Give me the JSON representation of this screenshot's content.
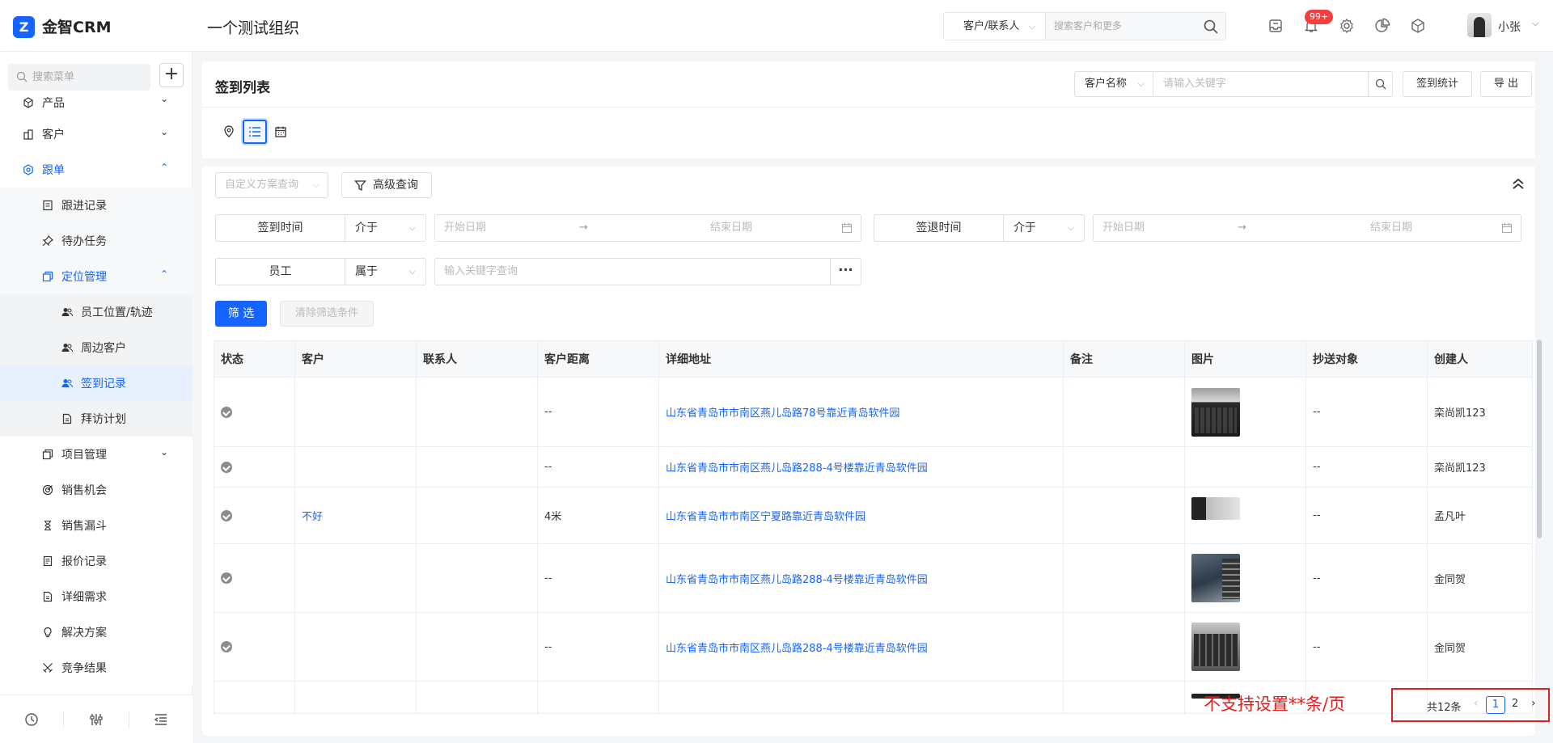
{
  "header": {
    "brand": "金智CRM",
    "org_title": "一个测试组织",
    "search_type": "客户/联系人",
    "search_placeholder": "搜索客户和更多",
    "notification_badge": "99+",
    "username": "小张"
  },
  "sidebar": {
    "search_placeholder": "搜索菜单",
    "add_label": "+",
    "items": [
      {
        "label": "产品",
        "level": 1,
        "arrow": "⌄",
        "icon": "cube-icon"
      },
      {
        "label": "客户",
        "level": 1,
        "arrow": "⌄",
        "icon": "building-icon"
      },
      {
        "label": "跟单",
        "level": 1,
        "arrow": "⌃",
        "icon": "hexagon-icon",
        "active": true
      },
      {
        "label": "跟进记录",
        "level": 2,
        "icon": "note-icon"
      },
      {
        "label": "待办任务",
        "level": 2,
        "icon": "pin-icon"
      },
      {
        "label": "定位管理",
        "level": 2,
        "arrow": "⌃",
        "icon": "copy-icon",
        "active": true
      },
      {
        "label": "员工位置/轨迹",
        "level": 3,
        "icon": "users-icon"
      },
      {
        "label": "周边客户",
        "level": 3,
        "icon": "users-icon"
      },
      {
        "label": "签到记录",
        "level": 3,
        "icon": "users-icon",
        "selected": true
      },
      {
        "label": "拜访计划",
        "level": 3,
        "icon": "doc-icon"
      },
      {
        "label": "项目管理",
        "level": 2,
        "arrow": "⌄",
        "icon": "copy-icon"
      },
      {
        "label": "销售机会",
        "level": 2,
        "icon": "target-icon"
      },
      {
        "label": "销售漏斗",
        "level": 2,
        "icon": "hourglass-icon"
      },
      {
        "label": "报价记录",
        "level": 2,
        "icon": "receipt-icon"
      },
      {
        "label": "详细需求",
        "level": 2,
        "icon": "doc-icon"
      },
      {
        "label": "解决方案",
        "level": 2,
        "icon": "bulb-icon"
      },
      {
        "label": "竞争结果",
        "level": 2,
        "icon": "swords-icon"
      }
    ]
  },
  "main": {
    "title": "签到列表",
    "search_field": "客户名称",
    "search_placeholder": "请输入关键字",
    "btn_stats": "签到统计",
    "btn_export": "导 出",
    "custom_scheme_placeholder": "自定义方案查询",
    "adv_query": "高级查询",
    "filters": {
      "checkin_label": "签到时间",
      "checkin_op": "介于",
      "checkin_start": "开始日期",
      "checkin_end": "结束日期",
      "checkout_label": "签退时间",
      "checkout_op": "介于",
      "checkout_start": "开始日期",
      "checkout_end": "结束日期",
      "employee_label": "员工",
      "employee_op": "属于",
      "employee_placeholder": "输入关键字查询",
      "range_arrow": "→",
      "more": "···"
    },
    "btn_filter": "筛 选",
    "btn_clear": "清除筛选条件",
    "columns": [
      "状态",
      "客户",
      "联系人",
      "客户距离",
      "详细地址",
      "备注",
      "图片",
      "抄送对象",
      "创建人"
    ],
    "rows": [
      {
        "customer": "",
        "contact": "",
        "distance": "--",
        "address": "山东省青岛市市南区燕儿岛路78号靠近青岛软件园",
        "note": "",
        "cc": "--",
        "creator": "栾尚凯123"
      },
      {
        "customer": "",
        "contact": "",
        "distance": "--",
        "address": "山东省青岛市市南区燕儿岛路288-4号楼靠近青岛软件园",
        "note": "",
        "cc": "--",
        "creator": "栾尚凯123"
      },
      {
        "customer": "不好",
        "contact": "",
        "distance": "4米",
        "address": "山东省青岛市市南区宁夏路靠近青岛软件园",
        "note": "",
        "cc": "--",
        "creator": "孟凡叶"
      },
      {
        "customer": "",
        "contact": "",
        "distance": "--",
        "address": "山东省青岛市市南区燕儿岛路288-4号楼靠近青岛软件园",
        "note": "",
        "cc": "--",
        "creator": "金同贺"
      },
      {
        "customer": "",
        "contact": "",
        "distance": "--",
        "address": "山东省青岛市市南区燕儿岛路288-4号楼靠近青岛软件园",
        "note": "",
        "cc": "--",
        "creator": "金同贺"
      }
    ],
    "pagination": {
      "total": "共12条",
      "current": "1",
      "page2": "2",
      "prev": "‹",
      "next": "›"
    },
    "annotation": "不支持设置**条/页"
  },
  "colors": {
    "accent": "#1664ff",
    "annotation": "#e0201f"
  }
}
